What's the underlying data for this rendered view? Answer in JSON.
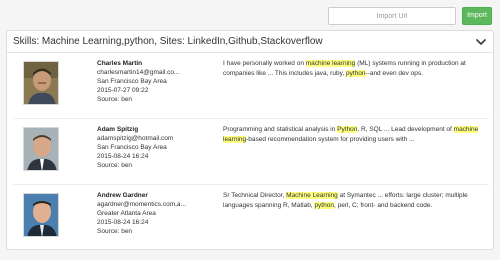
{
  "import_bar": {
    "placeholder": "Import Url",
    "value": "",
    "button_label": "Import"
  },
  "panel": {
    "title": "Skills: Machine Learning,python, Sites: LinkedIn,Github,Stackoverflow"
  },
  "colors": {
    "import_button": "#5cb85c",
    "highlight": "#ffff80"
  },
  "results": [
    {
      "name": "Charles Martin",
      "email": "charlesmartin14@gmail.co...",
      "location": "San Francisco Bay Area",
      "date": "2015-07-27 09:22",
      "source": "Source: ben",
      "snippet": [
        {
          "text": "I have personally worked on ",
          "hl": false
        },
        {
          "text": "machine learning",
          "hl": true
        },
        {
          "text": " (ML) systems running in production at companies like ... This includes java, ruby, ",
          "hl": false
        },
        {
          "text": "python",
          "hl": true
        },
        {
          "text": "--and even dev ops.",
          "hl": false
        }
      ]
    },
    {
      "name": "Adam Spitzig",
      "email": "adamspitzig@hotmail.com",
      "location": "San Francisco Bay Area",
      "date": "2015-08-24 16:24",
      "source": "Source: ben",
      "snippet": [
        {
          "text": "Programming and statistical analysis in ",
          "hl": false
        },
        {
          "text": "Python",
          "hl": true
        },
        {
          "text": ", R, SQL ... Lead development of ",
          "hl": false
        },
        {
          "text": "machine learning",
          "hl": true
        },
        {
          "text": "-based recommendation system for providing users with ...",
          "hl": false
        }
      ]
    },
    {
      "name": "Andrew Gardner",
      "email": "agardner@momentics.com,a...",
      "location": "Greater Atlanta Area",
      "date": "2015-08-24 16:24",
      "source": "Source: ben",
      "snippet": [
        {
          "text": "Sr Technical Director, ",
          "hl": false
        },
        {
          "text": "Machine Learning",
          "hl": true
        },
        {
          "text": " at Symantec ... efforts: large cluster; multiple languages spanning R, Matlab, ",
          "hl": false
        },
        {
          "text": "python",
          "hl": true
        },
        {
          "text": ", perl, C; front- and backend code.",
          "hl": false
        }
      ]
    }
  ]
}
